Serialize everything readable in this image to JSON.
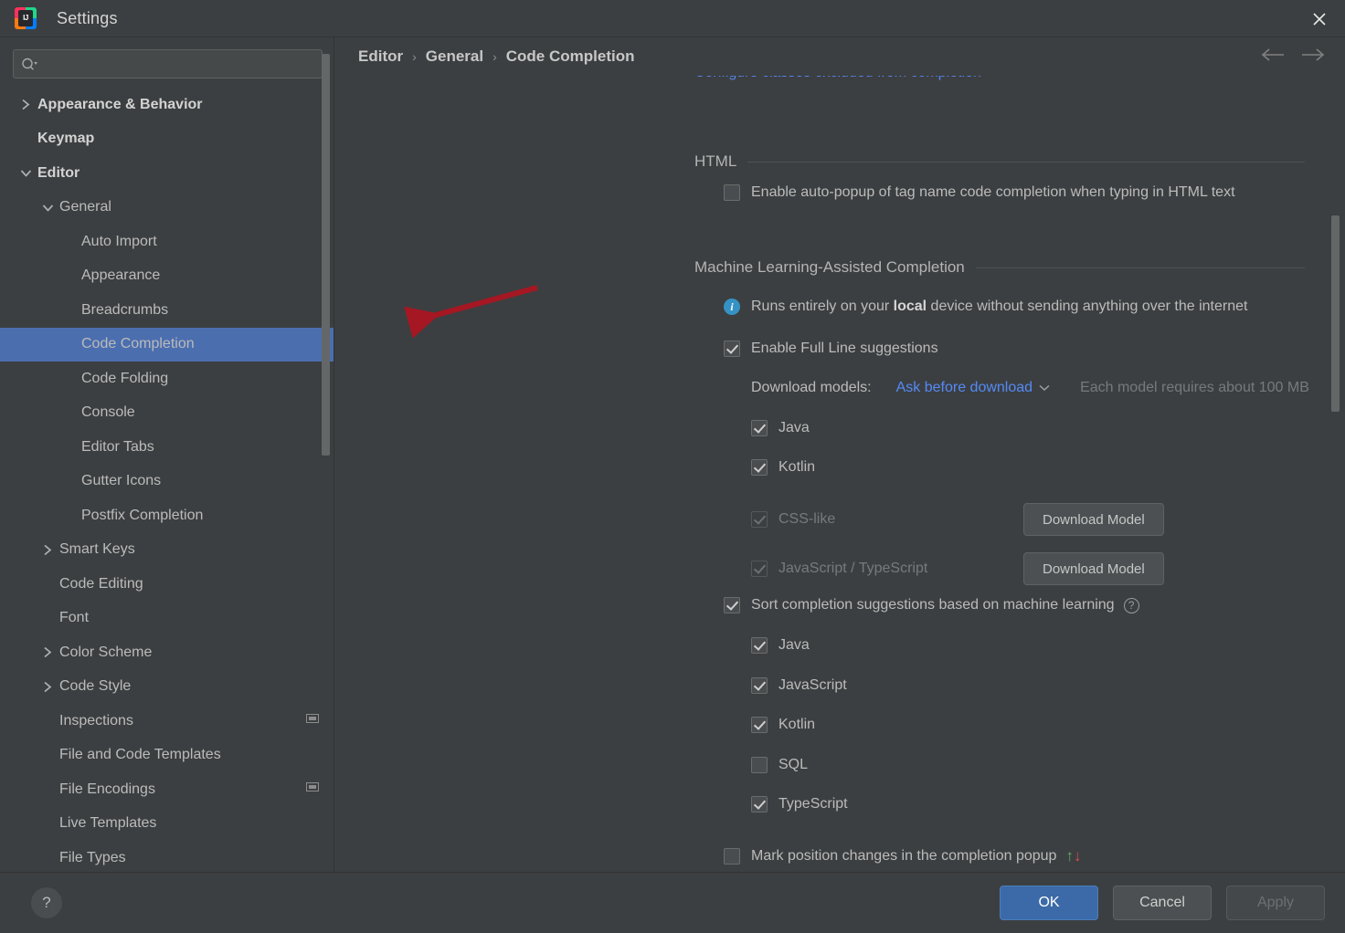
{
  "window": {
    "title": "Settings",
    "logo_text": "IJ",
    "close_icon": "close-icon"
  },
  "sidebar": {
    "search": {
      "value": "",
      "placeholder": ""
    },
    "items": [
      {
        "label": "Appearance & Behavior",
        "indent": 0,
        "twisty": "collapsed",
        "bold": true,
        "selected": false,
        "badge": false
      },
      {
        "label": "Keymap",
        "indent": 0,
        "twisty": "none",
        "bold": true,
        "selected": false,
        "badge": false
      },
      {
        "label": "Editor",
        "indent": 0,
        "twisty": "expanded",
        "bold": true,
        "selected": false,
        "badge": false
      },
      {
        "label": "General",
        "indent": 1,
        "twisty": "expanded",
        "bold": false,
        "selected": false,
        "badge": false
      },
      {
        "label": "Auto Import",
        "indent": 2,
        "twisty": "none",
        "bold": false,
        "selected": false,
        "badge": false
      },
      {
        "label": "Appearance",
        "indent": 2,
        "twisty": "none",
        "bold": false,
        "selected": false,
        "badge": false
      },
      {
        "label": "Breadcrumbs",
        "indent": 2,
        "twisty": "none",
        "bold": false,
        "selected": false,
        "badge": false
      },
      {
        "label": "Code Completion",
        "indent": 2,
        "twisty": "none",
        "bold": false,
        "selected": true,
        "badge": false
      },
      {
        "label": "Code Folding",
        "indent": 2,
        "twisty": "none",
        "bold": false,
        "selected": false,
        "badge": false
      },
      {
        "label": "Console",
        "indent": 2,
        "twisty": "none",
        "bold": false,
        "selected": false,
        "badge": false
      },
      {
        "label": "Editor Tabs",
        "indent": 2,
        "twisty": "none",
        "bold": false,
        "selected": false,
        "badge": false
      },
      {
        "label": "Gutter Icons",
        "indent": 2,
        "twisty": "none",
        "bold": false,
        "selected": false,
        "badge": false
      },
      {
        "label": "Postfix Completion",
        "indent": 2,
        "twisty": "none",
        "bold": false,
        "selected": false,
        "badge": false
      },
      {
        "label": "Smart Keys",
        "indent": 1,
        "twisty": "collapsed",
        "bold": false,
        "selected": false,
        "badge": false
      },
      {
        "label": "Code Editing",
        "indent": 1,
        "twisty": "none",
        "bold": false,
        "selected": false,
        "badge": false
      },
      {
        "label": "Font",
        "indent": 1,
        "twisty": "none",
        "bold": false,
        "selected": false,
        "badge": false
      },
      {
        "label": "Color Scheme",
        "indent": 1,
        "twisty": "collapsed",
        "bold": false,
        "selected": false,
        "badge": false
      },
      {
        "label": "Code Style",
        "indent": 1,
        "twisty": "collapsed",
        "bold": false,
        "selected": false,
        "badge": false
      },
      {
        "label": "Inspections",
        "indent": 1,
        "twisty": "none",
        "bold": false,
        "selected": false,
        "badge": true
      },
      {
        "label": "File and Code Templates",
        "indent": 1,
        "twisty": "none",
        "bold": false,
        "selected": false,
        "badge": false
      },
      {
        "label": "File Encodings",
        "indent": 1,
        "twisty": "none",
        "bold": false,
        "selected": false,
        "badge": true
      },
      {
        "label": "Live Templates",
        "indent": 1,
        "twisty": "none",
        "bold": false,
        "selected": false,
        "badge": false
      },
      {
        "label": "File Types",
        "indent": 1,
        "twisty": "none",
        "bold": false,
        "selected": false,
        "badge": false
      }
    ]
  },
  "breadcrumb": {
    "items": [
      "Editor",
      "General",
      "Code Completion"
    ],
    "separator": "›",
    "back_icon": "arrow-left-icon",
    "forward_icon": "arrow-right-icon"
  },
  "content": {
    "clipped_link": "Configure classes excluded from completion",
    "html_section": {
      "title": "HTML",
      "auto_popup": {
        "label": "Enable auto-popup of tag name code completion when typing in HTML text",
        "checked": false
      }
    },
    "ml_section": {
      "title": "Machine Learning-Assisted Completion",
      "info_note_prefix": "Runs entirely on your ",
      "info_note_bold": "local",
      "info_note_suffix": " device without sending anything over the internet",
      "full_line": {
        "label": "Enable Full Line suggestions",
        "checked": true
      },
      "download_models_label": "Download models:",
      "download_models_value": "Ask before download",
      "download_models_hint": "Each model requires about 100 MB",
      "full_line_languages": [
        {
          "label": "Java",
          "checked": true,
          "disabled": false,
          "button": null
        },
        {
          "label": "Kotlin",
          "checked": true,
          "disabled": false,
          "button": null
        },
        {
          "label": "CSS-like",
          "checked": true,
          "disabled": true,
          "button": "Download Model"
        },
        {
          "label": "JavaScript / TypeScript",
          "checked": true,
          "disabled": true,
          "button": "Download Model"
        }
      ],
      "sort_completion": {
        "label": "Sort completion suggestions based on machine learning",
        "checked": true,
        "help": "?"
      },
      "sort_languages": [
        {
          "label": "Java",
          "checked": true
        },
        {
          "label": "JavaScript",
          "checked": true
        },
        {
          "label": "Kotlin",
          "checked": true
        },
        {
          "label": "SQL",
          "checked": false
        },
        {
          "label": "TypeScript",
          "checked": true
        }
      ],
      "mark_position": {
        "label": "Mark position changes in the completion popup",
        "checked": false,
        "up_arrow": "↑",
        "down_arrow": "↓"
      }
    }
  },
  "footer": {
    "help_label": "?",
    "ok_label": "OK",
    "cancel_label": "Cancel",
    "apply_label": "Apply"
  },
  "colors": {
    "accent_selection": "#4b6eaf",
    "link": "#548af7",
    "primary_button": "#3c6aa8",
    "info_icon": "#3592c4",
    "annotation_arrow": "#a51723",
    "arrow_up": "#5fad65",
    "arrow_down": "#d0504f"
  }
}
